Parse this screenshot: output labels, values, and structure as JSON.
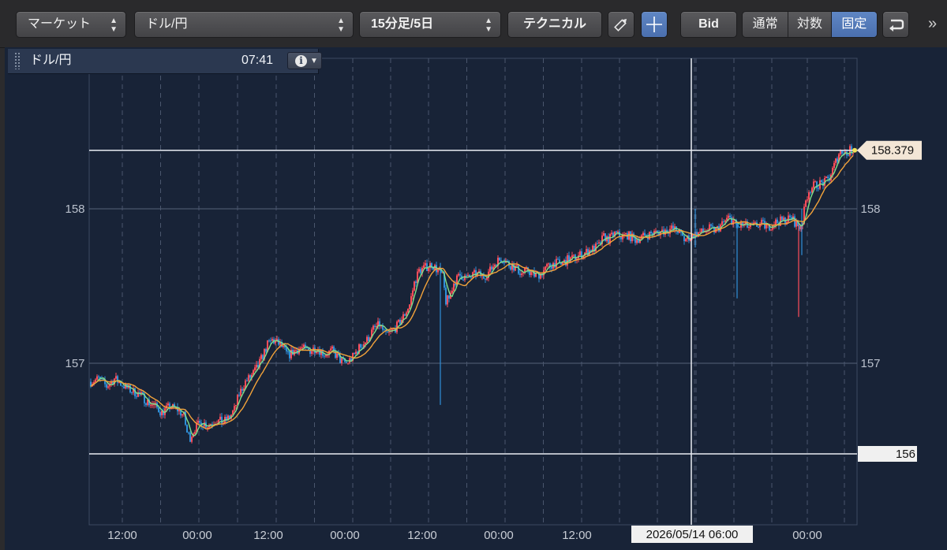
{
  "toolbar": {
    "market_label": "マーケット",
    "pair_label": "ドル/円",
    "timeframe_label": "15分足/5日",
    "technical_label": "テクニカル",
    "bid_label": "Bid",
    "scale_options": [
      "通常",
      "対数",
      "固定"
    ],
    "scale_selected": "固定",
    "more_label": "»"
  },
  "info_panel": {
    "symbol": "ドル/円",
    "time": "07:41",
    "info_icon_glyph": "i",
    "menu_icon_glyph": "▼"
  },
  "chart_data": {
    "type": "line",
    "series": [
      {
        "name": "",
        "kind": "candles",
        "color_up": "#ff4d5a",
        "color_down": "#2f8fd8"
      },
      {
        "name": "",
        "kind": "ma_short",
        "color": "#7fe08a"
      },
      {
        "name": "",
        "kind": "ma_long",
        "color": "#f3a33a"
      }
    ],
    "x_tick_labels": [
      "12:00",
      "00:00",
      "12:00",
      "00:00",
      "12:00",
      "00:00",
      "12:00",
      "00:00"
    ],
    "y_tick_labels": [
      "157",
      "158"
    ],
    "ylim": [
      155.5,
      158.6
    ],
    "grid": true,
    "crosshair": {
      "price_label": "156",
      "time_label": "2026/05/14 06:00"
    },
    "last_price_label": "158.379",
    "last_price": 158.379,
    "close_path": [
      [
        0,
        156.88
      ],
      [
        10,
        156.9
      ],
      [
        20,
        156.85
      ],
      [
        30,
        156.9
      ],
      [
        40,
        156.86
      ],
      [
        52,
        156.82
      ],
      [
        62,
        156.8
      ],
      [
        72,
        156.75
      ],
      [
        82,
        156.72
      ],
      [
        90,
        156.68
      ],
      [
        100,
        156.72
      ],
      [
        110,
        156.7
      ],
      [
        118,
        156.66
      ],
      [
        122,
        156.55
      ],
      [
        126,
        156.52
      ],
      [
        132,
        156.58
      ],
      [
        140,
        156.62
      ],
      [
        148,
        156.6
      ],
      [
        158,
        156.63
      ],
      [
        168,
        156.62
      ],
      [
        176,
        156.65
      ],
      [
        182,
        156.7
      ],
      [
        188,
        156.8
      ],
      [
        196,
        156.88
      ],
      [
        204,
        156.92
      ],
      [
        212,
        156.98
      ],
      [
        218,
        157.05
      ],
      [
        224,
        157.12
      ],
      [
        230,
        157.15
      ],
      [
        240,
        157.12
      ],
      [
        250,
        157.05
      ],
      [
        258,
        157.08
      ],
      [
        266,
        157.1
      ],
      [
        276,
        157.08
      ],
      [
        286,
        157.1
      ],
      [
        296,
        157.06
      ],
      [
        306,
        157.08
      ],
      [
        316,
        157.02
      ],
      [
        324,
        157.0
      ],
      [
        332,
        157.04
      ],
      [
        340,
        157.1
      ],
      [
        350,
        157.15
      ],
      [
        358,
        157.22
      ],
      [
        366,
        157.25
      ],
      [
        374,
        157.18
      ],
      [
        380,
        157.2
      ],
      [
        388,
        157.24
      ],
      [
        396,
        157.3
      ],
      [
        404,
        157.38
      ],
      [
        410,
        157.52
      ],
      [
        416,
        157.6
      ],
      [
        424,
        157.62
      ],
      [
        432,
        157.64
      ],
      [
        440,
        157.6
      ],
      [
        446,
        157.56
      ],
      [
        450,
        157.4
      ],
      [
        454,
        157.42
      ],
      [
        460,
        157.52
      ],
      [
        468,
        157.57
      ],
      [
        478,
        157.55
      ],
      [
        488,
        157.58
      ],
      [
        498,
        157.56
      ],
      [
        506,
        157.6
      ],
      [
        514,
        157.66
      ],
      [
        522,
        157.68
      ],
      [
        530,
        157.64
      ],
      [
        538,
        157.62
      ],
      [
        546,
        157.58
      ],
      [
        554,
        157.6
      ],
      [
        562,
        157.57
      ],
      [
        570,
        157.58
      ],
      [
        578,
        157.62
      ],
      [
        588,
        157.65
      ],
      [
        596,
        157.64
      ],
      [
        604,
        157.67
      ],
      [
        612,
        157.68
      ],
      [
        620,
        157.7
      ],
      [
        628,
        157.72
      ],
      [
        636,
        157.74
      ],
      [
        644,
        157.76
      ],
      [
        650,
        157.82
      ],
      [
        656,
        157.8
      ],
      [
        664,
        157.84
      ],
      [
        672,
        157.82
      ],
      [
        680,
        157.83
      ],
      [
        690,
        157.8
      ],
      [
        700,
        157.82
      ],
      [
        710,
        157.84
      ],
      [
        720,
        157.85
      ],
      [
        728,
        157.86
      ],
      [
        736,
        157.87
      ],
      [
        744,
        157.86
      ],
      [
        752,
        157.8
      ],
      [
        760,
        157.82
      ],
      [
        768,
        157.84
      ],
      [
        776,
        157.85
      ],
      [
        784,
        157.87
      ],
      [
        792,
        157.86
      ],
      [
        800,
        157.9
      ],
      [
        808,
        157.94
      ],
      [
        814,
        157.92
      ],
      [
        820,
        157.88
      ],
      [
        826,
        157.9
      ],
      [
        834,
        157.88
      ],
      [
        842,
        157.89
      ],
      [
        850,
        157.9
      ],
      [
        858,
        157.88
      ],
      [
        866,
        157.91
      ],
      [
        874,
        157.92
      ],
      [
        882,
        157.93
      ],
      [
        888,
        157.94
      ],
      [
        894,
        157.9
      ],
      [
        898,
        157.88
      ],
      [
        902,
        157.92
      ],
      [
        906,
        158.05
      ],
      [
        910,
        158.12
      ],
      [
        916,
        158.15
      ],
      [
        922,
        158.16
      ],
      [
        930,
        158.17
      ],
      [
        936,
        158.2
      ],
      [
        942,
        158.28
      ],
      [
        948,
        158.36
      ],
      [
        954,
        158.38
      ],
      [
        958,
        158.35
      ],
      [
        962,
        158.38
      ],
      [
        966,
        158.379
      ]
    ]
  }
}
